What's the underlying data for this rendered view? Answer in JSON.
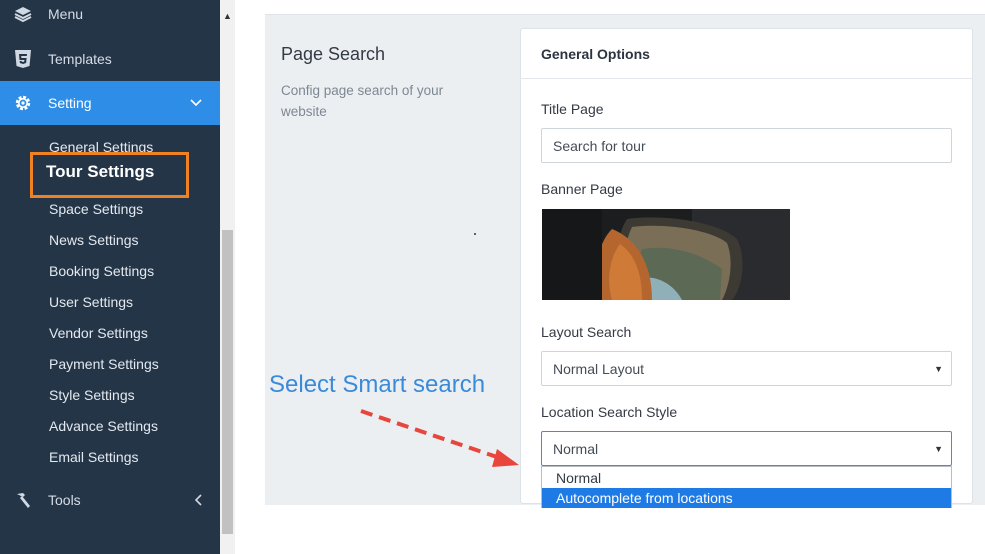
{
  "sidebar": {
    "menu_label": "Menu",
    "templates_label": "Templates",
    "setting_label": "Setting",
    "tools_label": "Tools",
    "sub_items": [
      "General Settings",
      "Tour Settings",
      "Space Settings",
      "News Settings",
      "Booking Settings",
      "User Settings",
      "Vendor Settings",
      "Payment Settings",
      "Style Settings",
      "Advance Settings",
      "Email Settings"
    ],
    "highlight_color": "#f08224",
    "active_color": "#2e8de6",
    "bg_color": "#253548"
  },
  "section": {
    "title": "Page Search",
    "description": "Config page search of your website"
  },
  "card": {
    "title": "General Options",
    "title_page_label": "Title Page",
    "title_page_value": "Search for tour",
    "banner_label": "Banner Page",
    "layout_label": "Layout Search",
    "layout_value": "Normal Layout",
    "location_label": "Location Search Style",
    "location_value": "Normal",
    "location_options": [
      "Normal",
      "Autocomplete from locations"
    ],
    "location_selected_index": 1
  },
  "annotation": {
    "text": "Select Smart search",
    "text_color": "#3b8ad8",
    "arrow_color": "#e8453c"
  }
}
